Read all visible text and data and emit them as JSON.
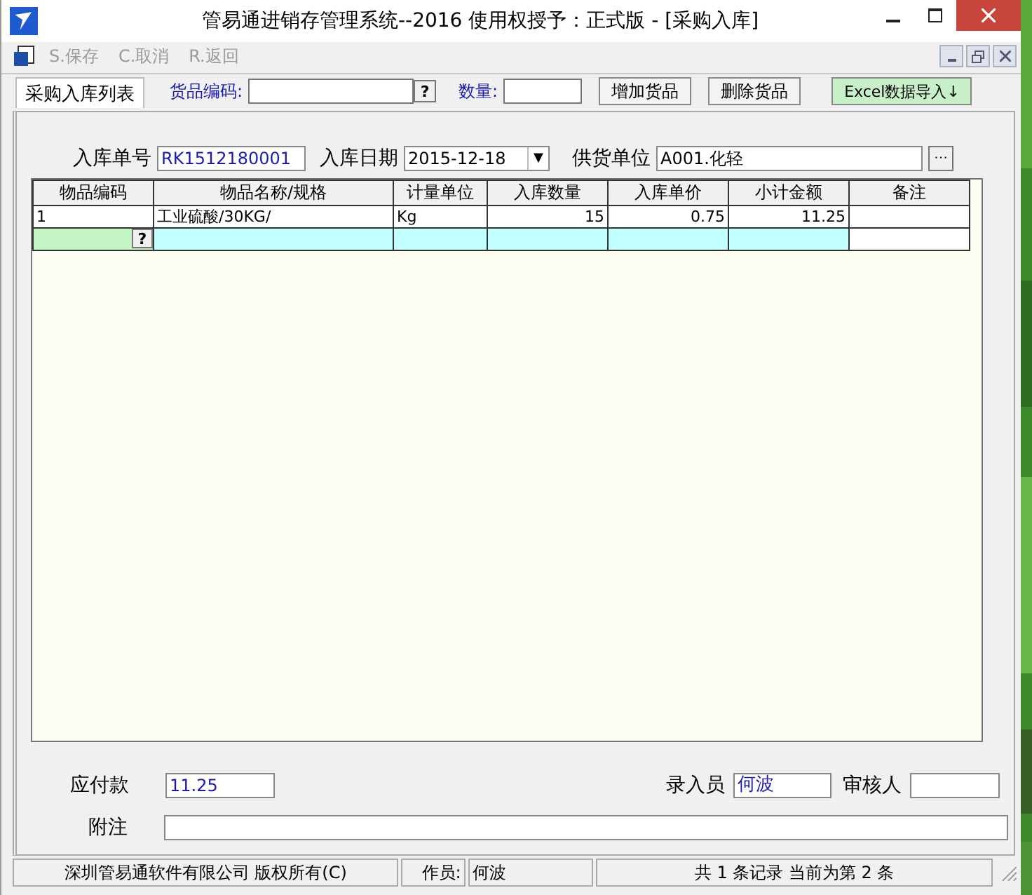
{
  "window": {
    "title": "管易通进销存管理系统--2016  使用权授予：正式版 - [采购入库]"
  },
  "toolbar": {
    "buttons": [
      {
        "label": "S.保存",
        "disabled": true
      },
      {
        "label": "C.取消",
        "disabled": true
      },
      {
        "label": "R.返回",
        "disabled": true
      }
    ]
  },
  "tabs": [
    {
      "label": "采购入库列表",
      "selected": false
    }
  ],
  "entry_bar": {
    "item_code_label": "货品编码:",
    "item_code_lookup": "?",
    "quantity_label": "数量:",
    "buttons": [
      {
        "label": "增加货品",
        "kind": "plain"
      },
      {
        "label": "删除货品",
        "kind": "plain"
      },
      {
        "label": "Excel数据导入↓",
        "kind": "excel"
      }
    ]
  },
  "form": {
    "receipt_no": {
      "label": "入库单号",
      "value": "RK1512180001"
    },
    "date": {
      "label": "入库日期",
      "value": "2015-12-18",
      "dropdown": "▼"
    },
    "supplier": {
      "label": "供货单位",
      "value": "A001.化轻",
      "browse": "···"
    }
  },
  "table": {
    "columns": [
      "物品编码",
      "物品名称/规格",
      "计量单位",
      "入库数量",
      "入库单价",
      "小计金额",
      "备注"
    ],
    "rows": [
      {
        "kind": "item",
        "cells": [
          "1",
          "工业硫酸/30KG/",
          "Kg",
          "15",
          "0.75",
          "11.25",
          ""
        ]
      },
      {
        "kind": "new",
        "lookup": "?",
        "cells": [
          "",
          "",
          "",
          "",
          "",
          "",
          ""
        ]
      }
    ]
  },
  "footer": {
    "payable": {
      "label": "应付款",
      "value": "11.25"
    },
    "entered_by": {
      "label": "录入员",
      "value": "何波"
    },
    "reviewer": {
      "label": "审核人"
    },
    "note": {
      "label": "附注"
    }
  },
  "status_bar": [
    "深圳管易通软件有限公司 版权所有(C)",
    "作员:",
    "何波",
    "共 1 条记录 当前为第 2 条"
  ]
}
